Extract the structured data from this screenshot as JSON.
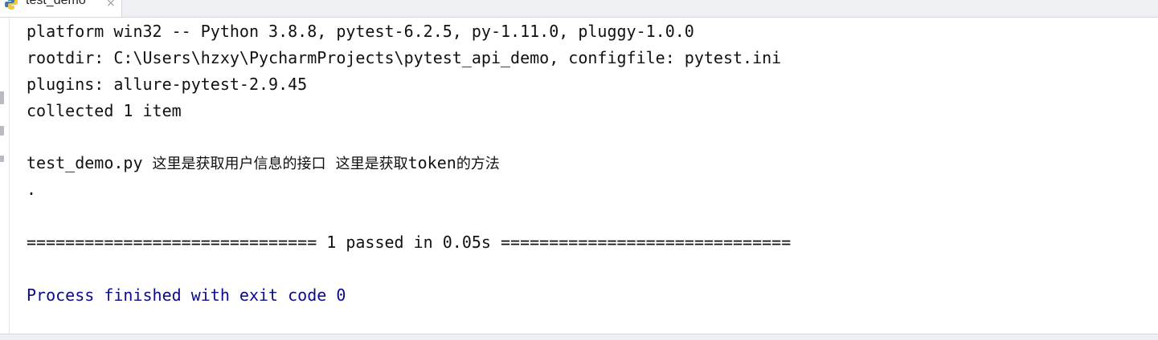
{
  "tab": {
    "label": "test_demo",
    "icon": "python-file-icon",
    "close_glyph": "×"
  },
  "console": {
    "platform_line": "platform win32 -- Python 3.8.8, pytest-6.2.5, py-1.11.0, pluggy-1.0.0",
    "rootdir_line": "rootdir: C:\\Users\\hzxy\\PycharmProjects\\pytest_api_demo, configfile: pytest.ini",
    "plugins_line": "plugins: allure-pytest-2.9.45",
    "collected_line": "collected 1 item",
    "test_file": "test_demo.py",
    "test_msg_1": "这里是获取用户信息的接口",
    "test_msg_2_prefix": "这里是获取",
    "test_msg_2_token": "token",
    "test_msg_2_suffix": "的方法",
    "progress_dot": ".",
    "summary_line": "============================== 1 passed in 0.05s ==============================",
    "exit_line": "Process finished with exit code 0"
  },
  "colors": {
    "text": "#111111",
    "exit_text": "#0b0b8c",
    "tabbar_bg": "#eef0f4"
  }
}
